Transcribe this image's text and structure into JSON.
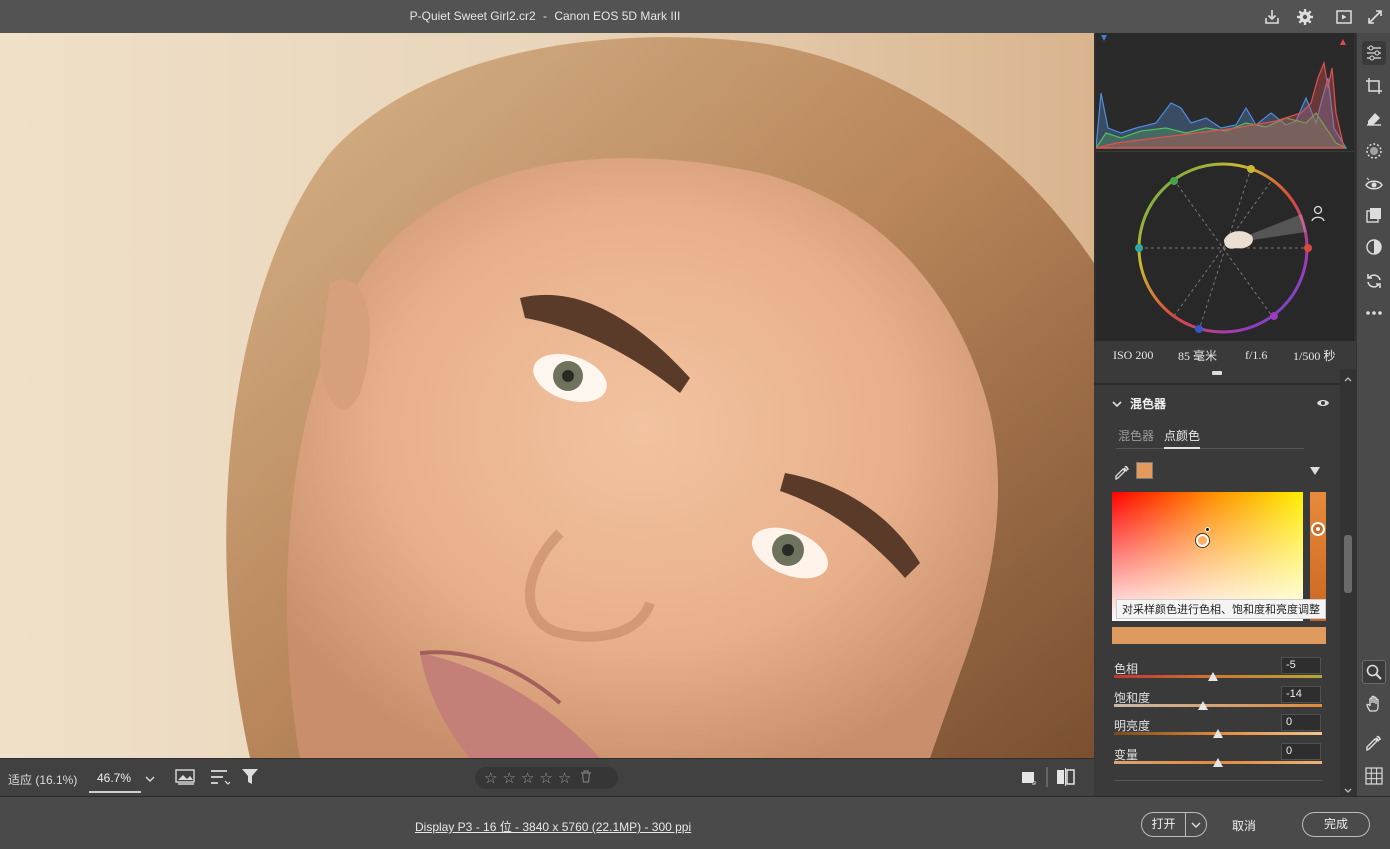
{
  "titlebar": {
    "filename": "P-Quiet Sweet Girl2.cr2",
    "separator": "-",
    "camera": "Canon EOS 5D Mark III"
  },
  "photo_toolbar": {
    "fit_label": "适应 (16.1%)",
    "zoom_value": "46.7%",
    "stars": [
      "☆",
      "☆",
      "☆",
      "☆",
      "☆"
    ]
  },
  "statusbar": {
    "info_link": "Display P3 - 16 位 - 3840 x 5760 (22.1MP) - 300 ppi",
    "open_label": "打开",
    "cancel_label": "取消",
    "done_label": "完成"
  },
  "exif": {
    "iso": "ISO 200",
    "focal": "85 毫米",
    "aperture": "f/1.6",
    "shutter": "1/500 秒"
  },
  "mixer": {
    "section_title": "混色器",
    "tab_mixer": "混色器",
    "tab_point_color": "点颜色",
    "sampled_color": "#e39a5c",
    "tooltip": "对采样颜色进行色相、饱和度和亮度调整",
    "sliders": [
      {
        "label": "色相",
        "value": "-5"
      },
      {
        "label": "饱和度",
        "value": "-14"
      },
      {
        "label": "明亮度",
        "value": "0"
      },
      {
        "label": "变量",
        "value": "0"
      }
    ]
  },
  "icons": {
    "titlebar": [
      "save-icon",
      "settings-icon",
      "slideshow-icon",
      "fullscreen-icon"
    ],
    "right_tools": [
      "edit-icon",
      "crop-icon",
      "heal-icon",
      "mask-icon",
      "redeye-icon",
      "presets-icon",
      "snapshots-icon",
      "sync-icon",
      "more-icon",
      "zoom-icon",
      "hand-icon",
      "color-sampler-icon",
      "grid-icon"
    ]
  }
}
